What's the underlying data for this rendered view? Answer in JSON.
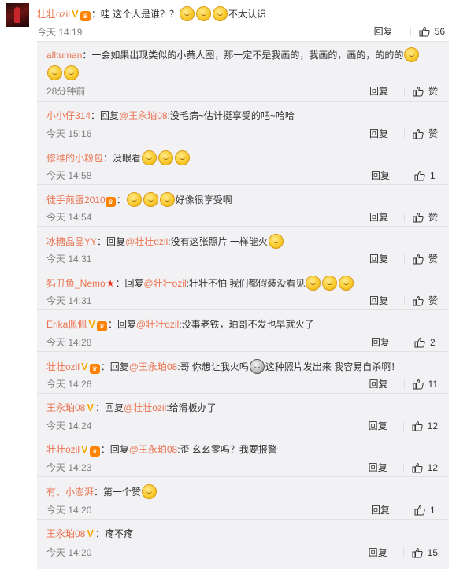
{
  "main_comment": {
    "user": "壮壮ozil",
    "text_a": "：哇 这个人是谁？？",
    "text_b": "不太认识",
    "time": "今天 14:19",
    "reply_label": "回复",
    "likes": "56",
    "icons": [
      "verified-v-icon",
      "level-badge-icon",
      "surprised-emoji"
    ]
  },
  "replies": [
    {
      "user": "alltuman",
      "text": "：一会如果出现类似的小黄人图，那一定不是我画的，我画的，画的，的的的",
      "time": "28分钟前",
      "reply_label": "回复",
      "like_label": "赞"
    },
    {
      "user": "小小仔314",
      "text_pre": "：回复",
      "mention": "@王永珀08",
      "text": ":没毛病~估计挺享受的吧~哈哈",
      "time": "今天 15:16",
      "reply_label": "回复",
      "like_label": "赞"
    },
    {
      "user": "修维的小粉包",
      "text": "：没眼看",
      "time": "今天 14:58",
      "reply_label": "回复",
      "likes": "1"
    },
    {
      "user": "徒手煎蛋2010",
      "text_pre": "：",
      "text": "好像很享受啊",
      "time": "今天 14:54",
      "reply_label": "回复",
      "like_label": "赞"
    },
    {
      "user": "冰糖晶晶YY",
      "text_pre": "：回复",
      "mention": "@壮壮ozil",
      "text": ":没有这张照片 一样能火",
      "time": "今天 14:31",
      "reply_label": "回复",
      "like_label": "赞"
    },
    {
      "user": "犸丑鱼_Nemo",
      "text_pre": "：回复",
      "mention": "@壮壮ozil",
      "text": ":壮壮不怕 我们都假装没看见",
      "time": "今天 14:31",
      "reply_label": "回复",
      "like_label": "赞"
    },
    {
      "user": "Erika佩佩",
      "text_pre": "：回复",
      "mention": "@壮壮ozil",
      "text": ":没事老铁，珀哥不发也早就火了",
      "time": "今天 14:28",
      "reply_label": "回复",
      "likes": "2"
    },
    {
      "user": "壮壮ozil",
      "text_pre": "：回复",
      "mention": "@王永珀08",
      "text": ":哥 你想让我火吗",
      "text_b": "这种照片发出来 我容易自杀啊！",
      "time": "今天 14:26",
      "reply_label": "回复",
      "likes": "11"
    },
    {
      "user": "王永珀08",
      "text_pre": "：回复",
      "mention": "@壮壮ozil",
      "text": ":给滑板办了",
      "time": "今天 14:24",
      "reply_label": "回复",
      "likes": "12"
    },
    {
      "user": "壮壮ozil",
      "text_pre": "：回复",
      "mention": "@王永珀08",
      "text": ":歪 幺幺零吗？我要报警",
      "time": "今天 14:23",
      "reply_label": "回复",
      "likes": "12"
    },
    {
      "user": "有、小澎湃",
      "text": "：第一个赞",
      "time": "今天 14:20",
      "reply_label": "回复",
      "likes": "1"
    },
    {
      "user": "王永珀08",
      "text": "：疼不疼",
      "time": "今天 14:20",
      "reply_label": "回复",
      "likes": "15"
    }
  ]
}
